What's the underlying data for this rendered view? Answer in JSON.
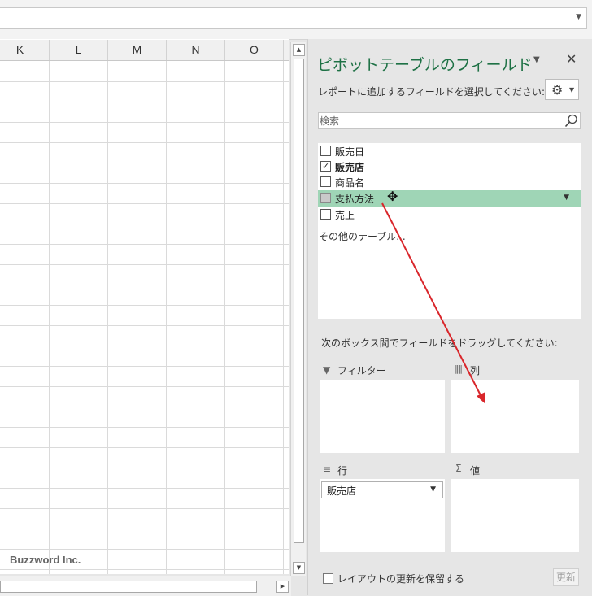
{
  "grid": {
    "columns": [
      "K",
      "L",
      "M",
      "N",
      "O"
    ],
    "watermark": "Buzzword Inc."
  },
  "pane": {
    "title": "ピボットテーブルのフィールド",
    "subtitle": "レポートに追加するフィールドを選択してください:",
    "search_placeholder": "検索",
    "fields": [
      {
        "label": "販売日",
        "checked": false,
        "bold": false
      },
      {
        "label": "販売店",
        "checked": true,
        "bold": true
      },
      {
        "label": "商品名",
        "checked": false,
        "bold": false
      },
      {
        "label": "支払方法",
        "checked": false,
        "bold": false,
        "highlighted": true
      },
      {
        "label": "売上",
        "checked": false,
        "bold": false
      }
    ],
    "other_tables": "その他のテーブル...",
    "drag_hint": "次のボックス間でフィールドをドラッグしてください:",
    "areas": {
      "filter": "フィルター",
      "columns": "列",
      "rows": "行",
      "values": "値"
    },
    "rows_items": [
      "販売店"
    ],
    "defer_label": "レイアウトの更新を保留する",
    "update_label": "更新"
  },
  "colors": {
    "title_green": "#1e7145",
    "highlight_green": "#9fd5b6",
    "arrow_red": "#d9262b"
  },
  "icons": {
    "gear": "gear-icon",
    "search": "search-icon",
    "close": "close-icon",
    "filter": "filter-icon",
    "columns": "columns-icon",
    "rows": "rows-icon",
    "values": "sigma-icon"
  }
}
